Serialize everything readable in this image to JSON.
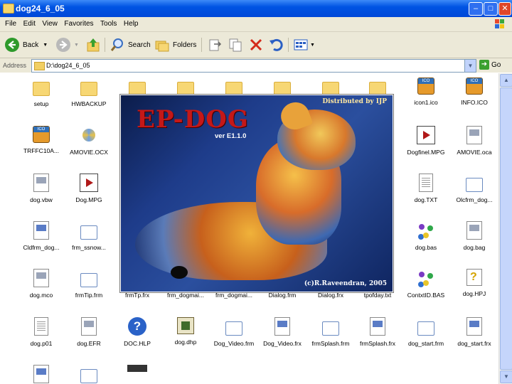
{
  "window": {
    "title": "dog24_6_05",
    "minimize": "–",
    "maximize": "□",
    "close": "✕"
  },
  "menu": [
    "File",
    "Edit",
    "View",
    "Favorites",
    "Tools",
    "Help"
  ],
  "toolbar": {
    "back": "Back",
    "search": "Search",
    "folders": "Folders"
  },
  "address": {
    "label": "Address",
    "value": "D:\\dog24_6_05",
    "go": "Go"
  },
  "splash": {
    "title": "EP-DOG",
    "version": "ver E1.1.0",
    "distributed": "Distributed by IJP",
    "copyright": "(c)R.Raveendran, 2005"
  },
  "files": {
    "r1": [
      "setup",
      "HWBACKUP",
      "",
      "",
      "",
      "",
      "",
      "",
      "icon1.ico",
      "INFO.ICO"
    ],
    "r2": [
      "TRFFC10A...",
      "AMOVIE.OCX",
      "Dogfinel.MPG",
      "AMOVIE.oca"
    ],
    "r3": [
      "dog.vbw",
      "Dog.MPG",
      "dog.TXT",
      "Olcfrm_dog..."
    ],
    "r4": [
      "Cldfrm_dog...",
      "frm_ssnow...",
      "dog.bas",
      "dog.bag"
    ],
    "r5": [
      "dog.mco",
      "frmTip.frm",
      "frmTp.frx",
      "frm_dogmai...",
      "frm_dogmai...",
      "Dialog.frm",
      "Dialog.frx",
      "tpofday.txt",
      "ContxtID.BAS",
      "dog.HPJ"
    ],
    "r6": [
      "dog.p01",
      "dog.EFR",
      "DOC.HLP",
      "dog.dhp",
      "Dog_Video.frm",
      "Dog_Video.frx",
      "frmSplash.frm",
      "frmSplash.frx",
      "dog_start.frm",
      "dog_start.frx"
    ]
  }
}
